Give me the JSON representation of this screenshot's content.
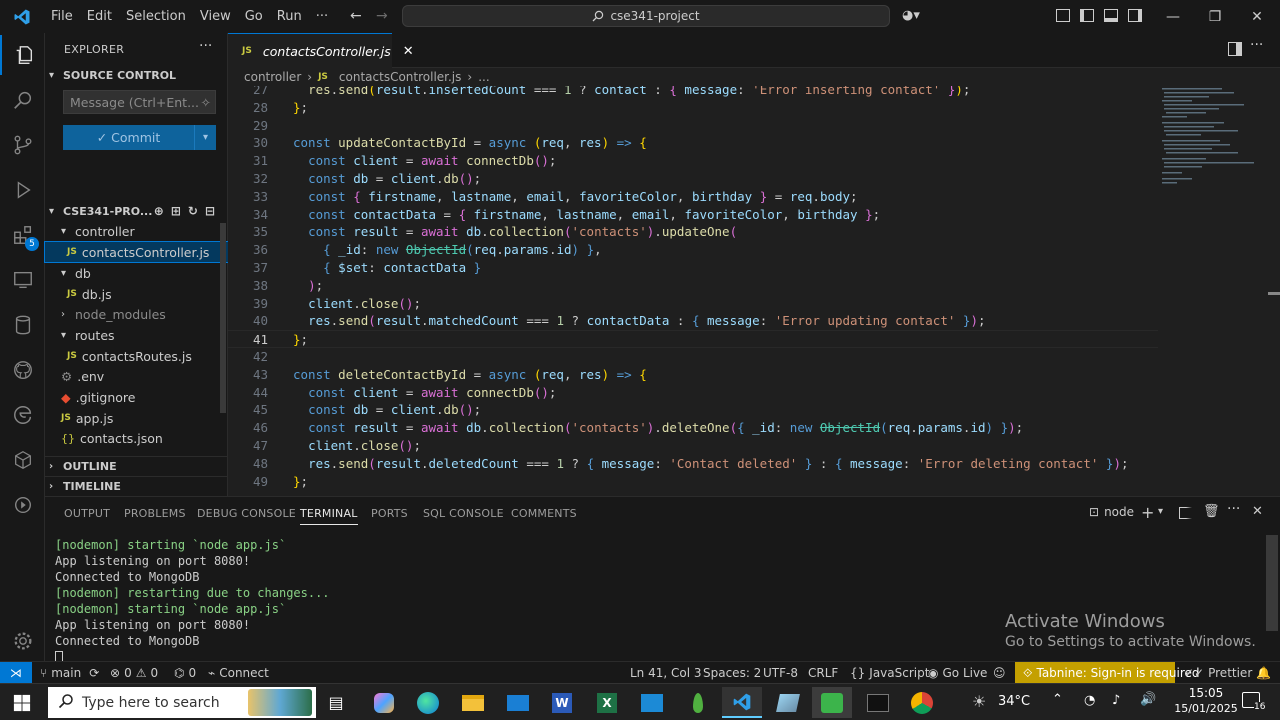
{
  "titlebar": {
    "menu": [
      "File",
      "Edit",
      "Selection",
      "View",
      "Go",
      "Run",
      "···"
    ],
    "search_text": "cse341-project"
  },
  "sidebar": {
    "explorer_title": "EXPLORER",
    "source_control_title": "SOURCE CONTROL",
    "message_placeholder": "Message (Ctrl+Ent...",
    "commit_label": "✓ Commit",
    "project_title": "CSE341-PRO...",
    "tree": [
      {
        "label": "controller",
        "type": "folder-open",
        "depth": 1
      },
      {
        "label": "contactsController.js",
        "type": "js",
        "depth": 2,
        "selected": true
      },
      {
        "label": "db",
        "type": "folder-open",
        "depth": 1
      },
      {
        "label": "db.js",
        "type": "js",
        "depth": 2
      },
      {
        "label": "node_modules",
        "type": "folder-closed",
        "depth": 1
      },
      {
        "label": "routes",
        "type": "folder-open",
        "depth": 1
      },
      {
        "label": "contactsRoutes.js",
        "type": "js",
        "depth": 2
      },
      {
        "label": ".env",
        "type": "gear",
        "depth": 1
      },
      {
        "label": ".gitignore",
        "type": "git",
        "depth": 1
      },
      {
        "label": "app.js",
        "type": "js",
        "depth": 1
      },
      {
        "label": "contacts.json",
        "type": "json",
        "depth": 1
      }
    ],
    "outline_title": "OUTLINE",
    "timeline_title": "TIMELINE",
    "scm_badge": "5"
  },
  "editor": {
    "tab_label": "contactsController.js",
    "breadcrumb": [
      "controller",
      "contactsController.js",
      "..."
    ],
    "current_line": 41
  },
  "panel": {
    "tabs": [
      "OUTPUT",
      "PROBLEMS",
      "DEBUG CONSOLE",
      "TERMINAL",
      "PORTS",
      "SQL CONSOLE",
      "COMMENTS"
    ],
    "active_tab": "TERMINAL",
    "terminal_name": "node",
    "terminal_lines": [
      {
        "text": "[nodemon] starting `node app.js`",
        "color": "green"
      },
      {
        "text": "App listening on port 8080!",
        "color": "white"
      },
      {
        "text": "Connected to MongoDB",
        "color": "white"
      },
      {
        "text": "[nodemon] restarting due to changes...",
        "color": "green"
      },
      {
        "text": "[nodemon] starting `node app.js`",
        "color": "green"
      },
      {
        "text": "App listening on port 8080!",
        "color": "white"
      },
      {
        "text": "Connected to MongoDB",
        "color": "white"
      }
    ],
    "watermark_title": "Activate Windows",
    "watermark_sub": "Go to Settings to activate Windows."
  },
  "statusbar": {
    "branch": "main",
    "errors": "0",
    "warnings": "0",
    "ports": "0",
    "connect": "Connect",
    "cursor": "Ln 41, Col 3",
    "spaces": "Spaces: 2",
    "encoding": "UTF-8",
    "eol": "CRLF",
    "language": "JavaScript",
    "golive": "Go Live",
    "tabnine": "Tabnine: Sign-in is required",
    "prettier": "Prettier"
  },
  "taskbar": {
    "search_placeholder": "Type here to search",
    "weather": "34°C",
    "time": "15:05",
    "date": "15/01/2025",
    "notif_count": "16"
  },
  "colors": {
    "accent": "#0078d4",
    "status_tabnine": "#c4a000"
  }
}
